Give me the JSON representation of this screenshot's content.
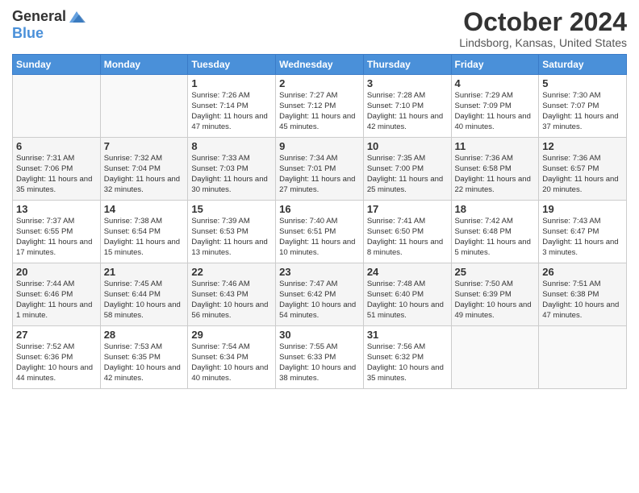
{
  "header": {
    "logo_general": "General",
    "logo_blue": "Blue",
    "title": "October 2024",
    "location": "Lindsborg, Kansas, United States"
  },
  "weekdays": [
    "Sunday",
    "Monday",
    "Tuesday",
    "Wednesday",
    "Thursday",
    "Friday",
    "Saturday"
  ],
  "weeks": [
    [
      {
        "day": "",
        "content": ""
      },
      {
        "day": "",
        "content": ""
      },
      {
        "day": "1",
        "content": "Sunrise: 7:26 AM\nSunset: 7:14 PM\nDaylight: 11 hours and 47 minutes."
      },
      {
        "day": "2",
        "content": "Sunrise: 7:27 AM\nSunset: 7:12 PM\nDaylight: 11 hours and 45 minutes."
      },
      {
        "day": "3",
        "content": "Sunrise: 7:28 AM\nSunset: 7:10 PM\nDaylight: 11 hours and 42 minutes."
      },
      {
        "day": "4",
        "content": "Sunrise: 7:29 AM\nSunset: 7:09 PM\nDaylight: 11 hours and 40 minutes."
      },
      {
        "day": "5",
        "content": "Sunrise: 7:30 AM\nSunset: 7:07 PM\nDaylight: 11 hours and 37 minutes."
      }
    ],
    [
      {
        "day": "6",
        "content": "Sunrise: 7:31 AM\nSunset: 7:06 PM\nDaylight: 11 hours and 35 minutes."
      },
      {
        "day": "7",
        "content": "Sunrise: 7:32 AM\nSunset: 7:04 PM\nDaylight: 11 hours and 32 minutes."
      },
      {
        "day": "8",
        "content": "Sunrise: 7:33 AM\nSunset: 7:03 PM\nDaylight: 11 hours and 30 minutes."
      },
      {
        "day": "9",
        "content": "Sunrise: 7:34 AM\nSunset: 7:01 PM\nDaylight: 11 hours and 27 minutes."
      },
      {
        "day": "10",
        "content": "Sunrise: 7:35 AM\nSunset: 7:00 PM\nDaylight: 11 hours and 25 minutes."
      },
      {
        "day": "11",
        "content": "Sunrise: 7:36 AM\nSunset: 6:58 PM\nDaylight: 11 hours and 22 minutes."
      },
      {
        "day": "12",
        "content": "Sunrise: 7:36 AM\nSunset: 6:57 PM\nDaylight: 11 hours and 20 minutes."
      }
    ],
    [
      {
        "day": "13",
        "content": "Sunrise: 7:37 AM\nSunset: 6:55 PM\nDaylight: 11 hours and 17 minutes."
      },
      {
        "day": "14",
        "content": "Sunrise: 7:38 AM\nSunset: 6:54 PM\nDaylight: 11 hours and 15 minutes."
      },
      {
        "day": "15",
        "content": "Sunrise: 7:39 AM\nSunset: 6:53 PM\nDaylight: 11 hours and 13 minutes."
      },
      {
        "day": "16",
        "content": "Sunrise: 7:40 AM\nSunset: 6:51 PM\nDaylight: 11 hours and 10 minutes."
      },
      {
        "day": "17",
        "content": "Sunrise: 7:41 AM\nSunset: 6:50 PM\nDaylight: 11 hours and 8 minutes."
      },
      {
        "day": "18",
        "content": "Sunrise: 7:42 AM\nSunset: 6:48 PM\nDaylight: 11 hours and 5 minutes."
      },
      {
        "day": "19",
        "content": "Sunrise: 7:43 AM\nSunset: 6:47 PM\nDaylight: 11 hours and 3 minutes."
      }
    ],
    [
      {
        "day": "20",
        "content": "Sunrise: 7:44 AM\nSunset: 6:46 PM\nDaylight: 11 hours and 1 minute."
      },
      {
        "day": "21",
        "content": "Sunrise: 7:45 AM\nSunset: 6:44 PM\nDaylight: 10 hours and 58 minutes."
      },
      {
        "day": "22",
        "content": "Sunrise: 7:46 AM\nSunset: 6:43 PM\nDaylight: 10 hours and 56 minutes."
      },
      {
        "day": "23",
        "content": "Sunrise: 7:47 AM\nSunset: 6:42 PM\nDaylight: 10 hours and 54 minutes."
      },
      {
        "day": "24",
        "content": "Sunrise: 7:48 AM\nSunset: 6:40 PM\nDaylight: 10 hours and 51 minutes."
      },
      {
        "day": "25",
        "content": "Sunrise: 7:50 AM\nSunset: 6:39 PM\nDaylight: 10 hours and 49 minutes."
      },
      {
        "day": "26",
        "content": "Sunrise: 7:51 AM\nSunset: 6:38 PM\nDaylight: 10 hours and 47 minutes."
      }
    ],
    [
      {
        "day": "27",
        "content": "Sunrise: 7:52 AM\nSunset: 6:36 PM\nDaylight: 10 hours and 44 minutes."
      },
      {
        "day": "28",
        "content": "Sunrise: 7:53 AM\nSunset: 6:35 PM\nDaylight: 10 hours and 42 minutes."
      },
      {
        "day": "29",
        "content": "Sunrise: 7:54 AM\nSunset: 6:34 PM\nDaylight: 10 hours and 40 minutes."
      },
      {
        "day": "30",
        "content": "Sunrise: 7:55 AM\nSunset: 6:33 PM\nDaylight: 10 hours and 38 minutes."
      },
      {
        "day": "31",
        "content": "Sunrise: 7:56 AM\nSunset: 6:32 PM\nDaylight: 10 hours and 35 minutes."
      },
      {
        "day": "",
        "content": ""
      },
      {
        "day": "",
        "content": ""
      }
    ]
  ]
}
